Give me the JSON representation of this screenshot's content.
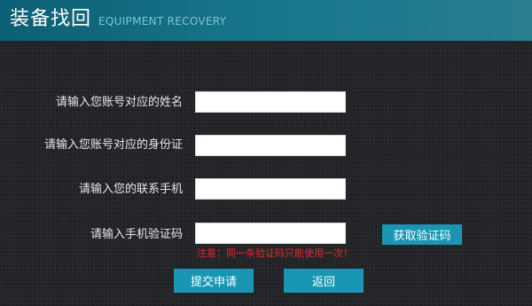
{
  "header": {
    "title": "装备找回",
    "subtitle": "EQUIPMENT RECOVERY"
  },
  "form": {
    "fields": [
      {
        "label": "请输入您账号对应的姓名",
        "value": "",
        "placeholder": ""
      },
      {
        "label": "请输入您账号对应的身份证",
        "value": "",
        "placeholder": ""
      },
      {
        "label": "请输入您的联系手机",
        "value": "",
        "placeholder": ""
      },
      {
        "label": "请输入手机验证码",
        "value": "",
        "placeholder": ""
      }
    ],
    "get_code_label": "获取验证码",
    "notice": "注意：同一条验证码只能使用一次！",
    "submit_label": "提交申请",
    "back_label": "返回"
  },
  "colors": {
    "header_start": "#0c5f74",
    "header_end": "#2a7d8f",
    "background": "#232528",
    "button": "#1896b4",
    "notice": "#e22b2b"
  }
}
